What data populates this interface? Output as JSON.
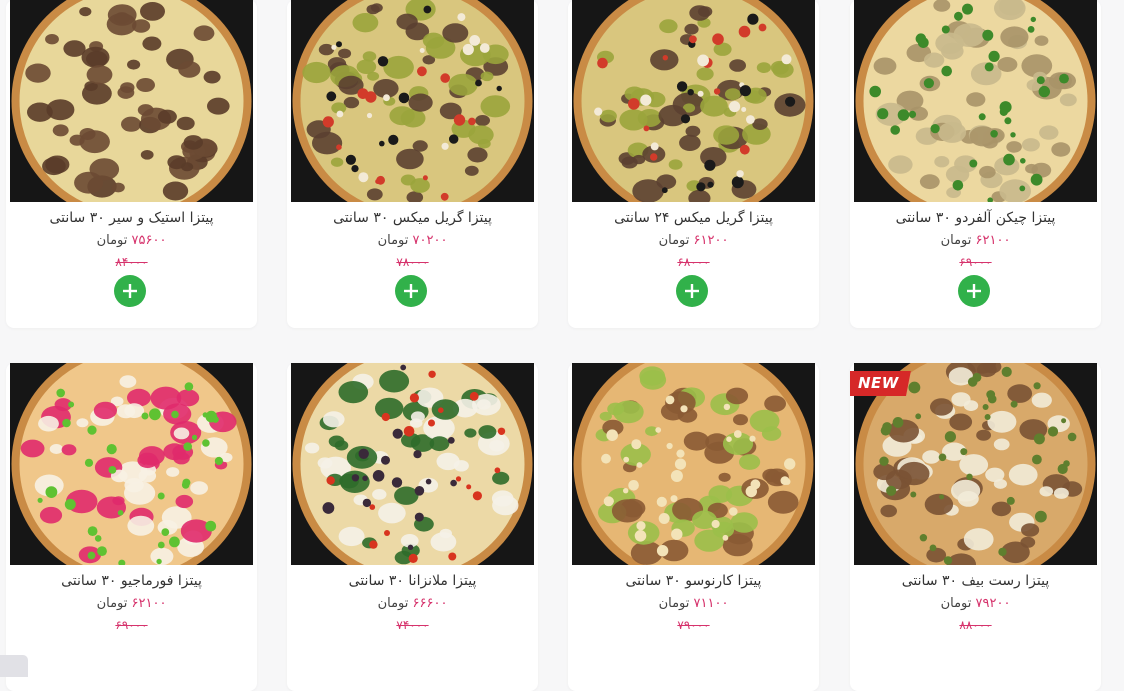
{
  "currency": "تومان",
  "badge_new": "NEW",
  "products": [
    {
      "name": "پیتزا استیک و سیر ۳۰ سانتی",
      "price": "۷۵۶۰۰",
      "old_price": "۸۴۰۰۰",
      "style": "steak"
    },
    {
      "name": "پیتزا گریل میکس ۳۰ سانتی",
      "price": "۷۰۲۰۰",
      "old_price": "۷۸۰۰۰",
      "style": "grill"
    },
    {
      "name": "پیتزا گریل میکس ۲۴ سانتی",
      "price": "۶۱۲۰۰",
      "old_price": "۶۸۰۰۰",
      "style": "grill"
    },
    {
      "name": "پیتزا چیکن آلفردو ۳۰ سانتی",
      "price": "۶۲۱۰۰",
      "old_price": "۶۹۰۰۰",
      "style": "chicken"
    },
    {
      "name": "پیتزا فورماجیو ۳۰ سانتی",
      "price": "۶۲۱۰۰",
      "old_price": "۶۹۰۰۰",
      "style": "formaggio"
    },
    {
      "name": "پیتزا ملانزانا ۳۰ سانتی",
      "price": "۶۶۶۰۰",
      "old_price": "۷۴۰۰۰",
      "style": "melanzana"
    },
    {
      "name": "پیتزا کارنوسو ۳۰ سانتی",
      "price": "۷۱۱۰۰",
      "old_price": "۷۹۰۰۰",
      "style": "carnoso"
    },
    {
      "name": "پیتزا رست بیف ۳۰ سانتی",
      "price": "۷۹۲۰۰",
      "old_price": "۸۸۰۰۰",
      "style": "roastbeef",
      "badge": "NEW"
    }
  ],
  "colors": {
    "accent": "#d6336c",
    "add_button": "#31b14a",
    "photo_bg": "#161616"
  },
  "icons": {
    "add": "plus-icon"
  }
}
